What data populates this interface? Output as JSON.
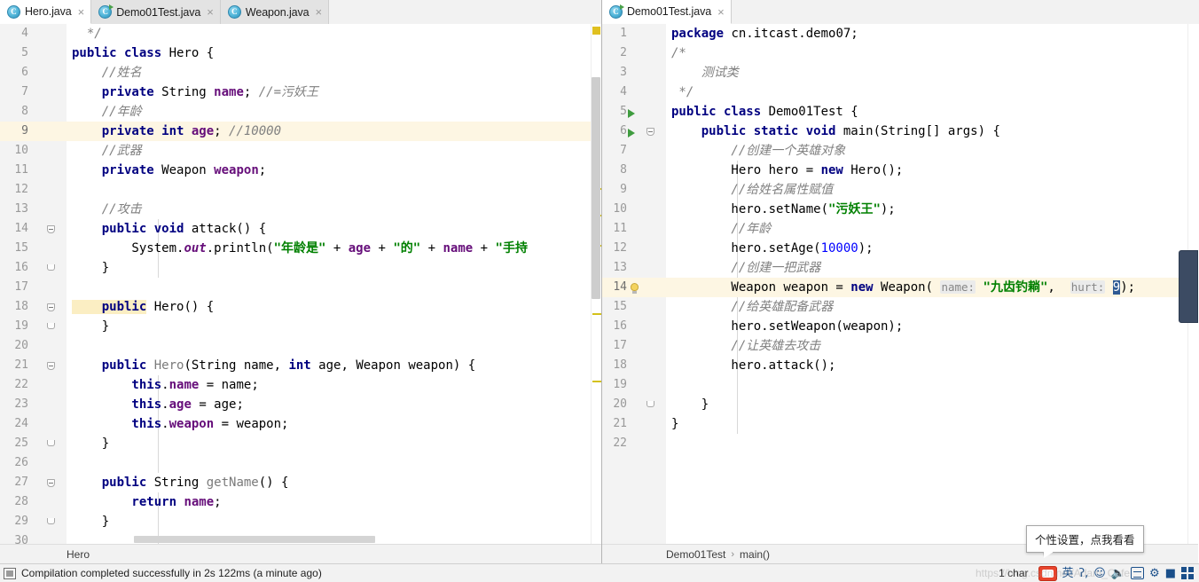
{
  "window": {
    "app": "IntelliJ IDEA",
    "accent_color": "#2f5a93",
    "highlight_line_color": "#fdf6e3",
    "marker_color": "#d4c11a"
  },
  "tabs": {
    "left_group": [
      {
        "label": "Hero.java",
        "icon": "java-class-icon",
        "active": true,
        "runnable": false,
        "close": "×"
      },
      {
        "label": "Demo01Test.java",
        "icon": "java-class-icon",
        "active": false,
        "runnable": true,
        "close": "×"
      },
      {
        "label": "Weapon.java",
        "icon": "java-class-icon",
        "active": false,
        "runnable": false,
        "close": "×"
      }
    ],
    "right_group": [
      {
        "label": "Demo01Test.java",
        "icon": "java-class-icon",
        "active": true,
        "runnable": true,
        "close": "×"
      }
    ]
  },
  "left_editor": {
    "file": "Hero.java",
    "first_line": 4,
    "breadcrumb": [
      "Hero"
    ],
    "lines": [
      {
        "n": 4,
        "marker": "",
        "highlight": false,
        "tokens": [
          {
            "t": "  */",
            "c": "doc"
          }
        ]
      },
      {
        "n": 5,
        "marker": "",
        "highlight": false,
        "tokens": [
          {
            "t": "public class ",
            "c": "kw"
          },
          {
            "t": "Hero {",
            "c": "ident"
          }
        ]
      },
      {
        "n": 6,
        "marker": "",
        "highlight": false,
        "tokens": [
          {
            "t": "    //姓名",
            "c": "cmt"
          }
        ]
      },
      {
        "n": 7,
        "marker": "",
        "highlight": false,
        "tokens": [
          {
            "t": "    private ",
            "c": "kw"
          },
          {
            "t": "String ",
            "c": "ident"
          },
          {
            "t": "name",
            "c": "field"
          },
          {
            "t": "; ",
            "c": "ident"
          },
          {
            "t": "//=污妖王",
            "c": "cmt"
          }
        ]
      },
      {
        "n": 8,
        "marker": "",
        "highlight": false,
        "tokens": [
          {
            "t": "    //年龄",
            "c": "cmt"
          }
        ]
      },
      {
        "n": 9,
        "marker": "",
        "highlight": true,
        "tokens": [
          {
            "t": "    private int ",
            "c": "kw"
          },
          {
            "t": "age",
            "c": "field"
          },
          {
            "t": "; ",
            "c": "ident"
          },
          {
            "t": "//10000",
            "c": "cmt"
          }
        ]
      },
      {
        "n": 10,
        "marker": "",
        "highlight": false,
        "tokens": [
          {
            "t": "    //武器",
            "c": "cmt"
          }
        ]
      },
      {
        "n": 11,
        "marker": "",
        "highlight": false,
        "tokens": [
          {
            "t": "    private ",
            "c": "kw"
          },
          {
            "t": "Weapon ",
            "c": "ident"
          },
          {
            "t": "weapon",
            "c": "field"
          },
          {
            "t": ";",
            "c": "ident"
          }
        ]
      },
      {
        "n": 12,
        "marker": "",
        "highlight": false,
        "tokens": [
          {
            "t": "",
            "c": "ident"
          }
        ]
      },
      {
        "n": 13,
        "marker": "",
        "highlight": false,
        "tokens": [
          {
            "t": "    //攻击",
            "c": "cmt"
          }
        ]
      },
      {
        "n": 14,
        "marker": "fold-open",
        "highlight": false,
        "tokens": [
          {
            "t": "    public void ",
            "c": "kw"
          },
          {
            "t": "attack() {",
            "c": "ident"
          }
        ]
      },
      {
        "n": 15,
        "marker": "",
        "highlight": false,
        "tokens": [
          {
            "t": "        System.",
            "c": "ident"
          },
          {
            "t": "out",
            "c": "static"
          },
          {
            "t": ".println(",
            "c": "ident"
          },
          {
            "t": "\"年龄是\"",
            "c": "str"
          },
          {
            "t": " + ",
            "c": "ident"
          },
          {
            "t": "age",
            "c": "field"
          },
          {
            "t": " + ",
            "c": "ident"
          },
          {
            "t": "\"的\"",
            "c": "str"
          },
          {
            "t": " + ",
            "c": "ident"
          },
          {
            "t": "name",
            "c": "field"
          },
          {
            "t": " + ",
            "c": "ident"
          },
          {
            "t": "\"手持",
            "c": "str"
          }
        ]
      },
      {
        "n": 16,
        "marker": "fold-close",
        "highlight": false,
        "tokens": [
          {
            "t": "    }",
            "c": "ident"
          }
        ]
      },
      {
        "n": 17,
        "marker": "",
        "highlight": false,
        "tokens": [
          {
            "t": "",
            "c": "ident"
          }
        ]
      },
      {
        "n": 18,
        "marker": "fold-open",
        "highlight": false,
        "tokens": [
          {
            "t": "    public",
            "c": "kw",
            "hl": true
          },
          {
            "t": " Hero() {",
            "c": "ident"
          }
        ]
      },
      {
        "n": 19,
        "marker": "fold-close",
        "highlight": false,
        "tokens": [
          {
            "t": "    }",
            "c": "ident"
          }
        ]
      },
      {
        "n": 20,
        "marker": "",
        "highlight": false,
        "tokens": [
          {
            "t": "",
            "c": "ident"
          }
        ]
      },
      {
        "n": 21,
        "marker": "fold-open",
        "highlight": false,
        "tokens": [
          {
            "t": "    public ",
            "c": "kw"
          },
          {
            "t": "Hero",
            "c": "mthd"
          },
          {
            "t": "(String name, ",
            "c": "ident"
          },
          {
            "t": "int",
            "c": "kw"
          },
          {
            "t": " age, Weapon weapon) {",
            "c": "ident"
          }
        ]
      },
      {
        "n": 22,
        "marker": "",
        "highlight": false,
        "tokens": [
          {
            "t": "        this",
            "c": "kw"
          },
          {
            "t": ".",
            "c": "ident"
          },
          {
            "t": "name",
            "c": "field"
          },
          {
            "t": " = name;",
            "c": "ident"
          }
        ]
      },
      {
        "n": 23,
        "marker": "",
        "highlight": false,
        "tokens": [
          {
            "t": "        this",
            "c": "kw"
          },
          {
            "t": ".",
            "c": "ident"
          },
          {
            "t": "age",
            "c": "field"
          },
          {
            "t": " = age;",
            "c": "ident"
          }
        ]
      },
      {
        "n": 24,
        "marker": "",
        "highlight": false,
        "tokens": [
          {
            "t": "        this",
            "c": "kw"
          },
          {
            "t": ".",
            "c": "ident"
          },
          {
            "t": "weapon",
            "c": "field"
          },
          {
            "t": " = weapon;",
            "c": "ident"
          }
        ]
      },
      {
        "n": 25,
        "marker": "fold-close",
        "highlight": false,
        "tokens": [
          {
            "t": "    }",
            "c": "ident"
          }
        ]
      },
      {
        "n": 26,
        "marker": "",
        "highlight": false,
        "tokens": [
          {
            "t": "",
            "c": "ident"
          }
        ]
      },
      {
        "n": 27,
        "marker": "fold-open",
        "highlight": false,
        "tokens": [
          {
            "t": "    public ",
            "c": "kw"
          },
          {
            "t": "String ",
            "c": "ident"
          },
          {
            "t": "getName",
            "c": "mthd"
          },
          {
            "t": "() {",
            "c": "ident"
          }
        ]
      },
      {
        "n": 28,
        "marker": "",
        "highlight": false,
        "tokens": [
          {
            "t": "        return ",
            "c": "kw"
          },
          {
            "t": "name",
            "c": "field"
          },
          {
            "t": ";",
            "c": "ident"
          }
        ]
      },
      {
        "n": 29,
        "marker": "fold-close",
        "highlight": false,
        "tokens": [
          {
            "t": "    }",
            "c": "ident"
          }
        ]
      },
      {
        "n": 30,
        "marker": "",
        "highlight": false,
        "tokens": [
          {
            "t": "",
            "c": "ident"
          }
        ]
      }
    ]
  },
  "right_editor": {
    "file": "Demo01Test.java",
    "first_line": 1,
    "breadcrumb": [
      "Demo01Test",
      "main()"
    ],
    "crumb_separator": "›",
    "lines": [
      {
        "n": 1,
        "marker": "",
        "highlight": false,
        "tokens": [
          {
            "t": "package ",
            "c": "kw"
          },
          {
            "t": "cn.itcast.demo07;",
            "c": "ident"
          }
        ]
      },
      {
        "n": 2,
        "marker": "",
        "highlight": false,
        "tokens": [
          {
            "t": "/*",
            "c": "doc"
          }
        ]
      },
      {
        "n": 3,
        "marker": "",
        "highlight": false,
        "tokens": [
          {
            "t": "    测试类",
            "c": "doc"
          }
        ]
      },
      {
        "n": 4,
        "marker": "",
        "highlight": false,
        "tokens": [
          {
            "t": " */",
            "c": "doc"
          }
        ]
      },
      {
        "n": 5,
        "marker": "run",
        "highlight": false,
        "tokens": [
          {
            "t": "public class ",
            "c": "kw"
          },
          {
            "t": "Demo01Test {",
            "c": "ident"
          }
        ]
      },
      {
        "n": 6,
        "marker": "run-fold",
        "highlight": false,
        "tokens": [
          {
            "t": "    public static void ",
            "c": "kw"
          },
          {
            "t": "main(String[] args) {",
            "c": "ident"
          }
        ]
      },
      {
        "n": 7,
        "marker": "",
        "highlight": false,
        "tokens": [
          {
            "t": "        //创建一个英雄对象",
            "c": "cmt"
          }
        ]
      },
      {
        "n": 8,
        "marker": "",
        "highlight": false,
        "tokens": [
          {
            "t": "        Hero hero = ",
            "c": "ident"
          },
          {
            "t": "new ",
            "c": "kw"
          },
          {
            "t": "Hero();",
            "c": "ident"
          }
        ]
      },
      {
        "n": 9,
        "marker": "",
        "highlight": false,
        "tokens": [
          {
            "t": "        //给姓名属性赋值",
            "c": "cmt"
          }
        ]
      },
      {
        "n": 10,
        "marker": "",
        "highlight": false,
        "tokens": [
          {
            "t": "        hero.setName(",
            "c": "ident"
          },
          {
            "t": "\"污妖王\"",
            "c": "str"
          },
          {
            "t": ");",
            "c": "ident"
          }
        ]
      },
      {
        "n": 11,
        "marker": "",
        "highlight": false,
        "tokens": [
          {
            "t": "        //年龄",
            "c": "cmt"
          }
        ]
      },
      {
        "n": 12,
        "marker": "",
        "highlight": false,
        "tokens": [
          {
            "t": "        hero.setAge(",
            "c": "ident"
          },
          {
            "t": "10000",
            "c": "num"
          },
          {
            "t": ");",
            "c": "ident"
          }
        ]
      },
      {
        "n": 13,
        "marker": "",
        "highlight": false,
        "tokens": [
          {
            "t": "        //创建一把武器",
            "c": "cmt"
          }
        ]
      },
      {
        "n": 14,
        "marker": "bulb",
        "highlight": true,
        "tokens": [
          {
            "t": "        Weapon weapon = ",
            "c": "ident"
          },
          {
            "t": "new ",
            "c": "kw"
          },
          {
            "t": "Weapon( ",
            "c": "ident"
          },
          {
            "t": "name:",
            "c": "hint"
          },
          {
            "t": " ",
            "c": "ident"
          },
          {
            "t": "\"九齿钓耥\"",
            "c": "str"
          },
          {
            "t": ",  ",
            "c": "ident"
          },
          {
            "t": "hurt:",
            "c": "hint"
          },
          {
            "t": " ",
            "c": "ident"
          },
          {
            "t": "9",
            "c": "sel"
          },
          {
            "t": ");",
            "c": "ident"
          }
        ]
      },
      {
        "n": 15,
        "marker": "",
        "highlight": false,
        "tokens": [
          {
            "t": "        //给英雄配备武器",
            "c": "cmt"
          }
        ]
      },
      {
        "n": 16,
        "marker": "",
        "highlight": false,
        "tokens": [
          {
            "t": "        hero.setWeapon(weapon);",
            "c": "ident"
          }
        ]
      },
      {
        "n": 17,
        "marker": "",
        "highlight": false,
        "tokens": [
          {
            "t": "        //让英雄去攻击",
            "c": "cmt"
          }
        ]
      },
      {
        "n": 18,
        "marker": "",
        "highlight": false,
        "tokens": [
          {
            "t": "        hero.attack();",
            "c": "ident"
          }
        ]
      },
      {
        "n": 19,
        "marker": "",
        "highlight": false,
        "tokens": [
          {
            "t": "",
            "c": "ident"
          }
        ]
      },
      {
        "n": 20,
        "marker": "fold-close",
        "highlight": false,
        "tokens": [
          {
            "t": "    }",
            "c": "ident"
          }
        ]
      },
      {
        "n": 21,
        "marker": "",
        "highlight": false,
        "tokens": [
          {
            "t": "}",
            "c": "ident"
          }
        ]
      },
      {
        "n": 22,
        "marker": "",
        "highlight": false,
        "tokens": [
          {
            "t": "",
            "c": "ident"
          }
        ]
      }
    ]
  },
  "tooltip": {
    "text": "个性设置，点我看看"
  },
  "statusbar": {
    "message": "Compilation completed successfully in 2s 122ms (a minute ago)",
    "char_count": "1 char",
    "ime": {
      "sogou": "sogou-ime-logo",
      "mode_label": "英",
      "punct_label": "ʔ,",
      "emoji": "☺",
      "mic": "mic-icon",
      "keyboard": "keyboard-icon",
      "toolbox": "toolbox-icon",
      "skin": "skin-icon",
      "apps": "apps-grid-icon"
    }
  },
  "watermark": {
    "text": "https://blog.csdn.net/Adam_Cafe"
  }
}
